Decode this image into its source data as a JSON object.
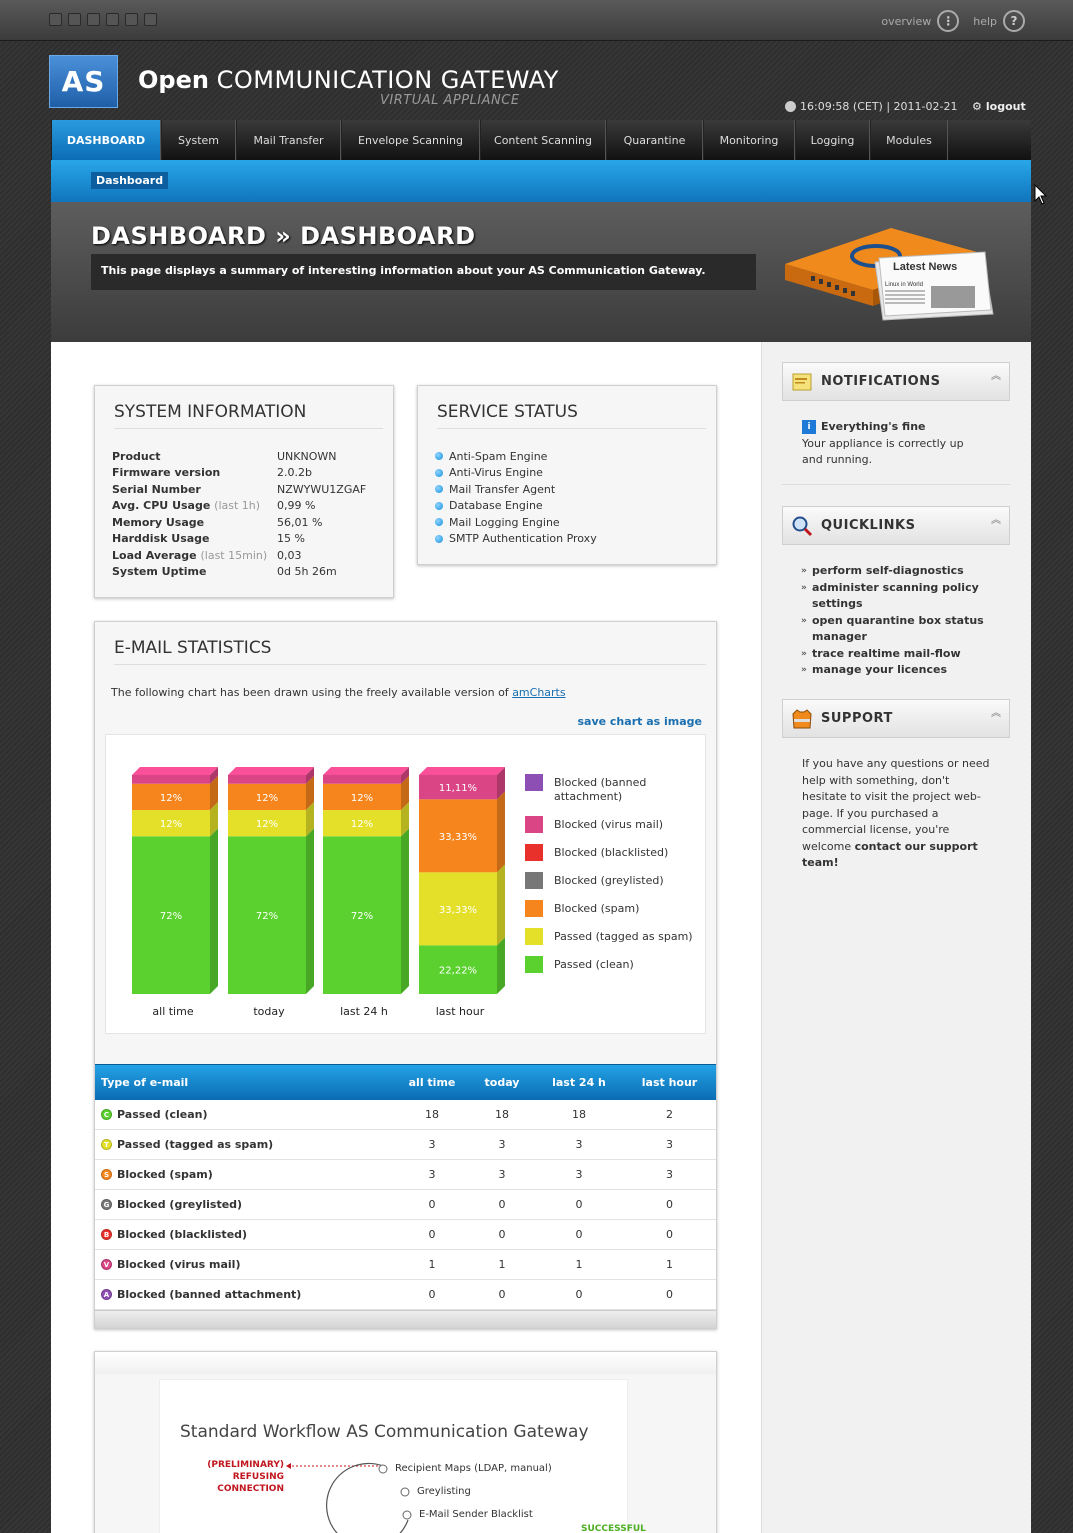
{
  "header": {
    "links": {
      "overview": "overview",
      "help": "help"
    },
    "logo_text": "AS",
    "brand_bold": "Open",
    "brand_rest": "COMMUNICATION GATEWAY",
    "brand_sub": "VIRTUAL APPLIANCE",
    "time": "16:09:58 (CET) | 2011-02-21",
    "logout": "logout"
  },
  "nav": {
    "tabs": [
      "DASHBOARD",
      "System",
      "Mail Transfer",
      "Envelope Scanning",
      "Content Scanning",
      "Quarantine",
      "Monitoring",
      "Logging",
      "Modules"
    ],
    "active": "DASHBOARD"
  },
  "subnav": {
    "item": "Dashboard"
  },
  "hero": {
    "title": "DASHBOARD » DASHBOARD",
    "description": "This page displays a summary of interesting information about your AS Communication Gateway.",
    "news_label": "Latest News",
    "news_headline": "Linux in World"
  },
  "system_info": {
    "title": "SYSTEM INFORMATION",
    "rows": [
      {
        "key": "Product",
        "note": "",
        "value": "UNKNOWN"
      },
      {
        "key": "Firmware version",
        "note": "",
        "value": "2.0.2b"
      },
      {
        "key": "Serial Number",
        "note": "",
        "value": "NZWYWU1ZGAF"
      },
      {
        "key": "Avg. CPU Usage",
        "note": "(last 1h)",
        "value": "0,99 %"
      },
      {
        "key": "Memory Usage",
        "note": "",
        "value": "56,01 %"
      },
      {
        "key": "Harddisk Usage",
        "note": "",
        "value": "15 %"
      },
      {
        "key": "Load Average",
        "note": "(last 15min)",
        "value": "0,03"
      },
      {
        "key": "System Uptime",
        "note": "",
        "value": "0d 5h 26m"
      }
    ]
  },
  "service_status": {
    "title": "SERVICE STATUS",
    "items": [
      "Anti-Spam Engine",
      "Anti-Virus Engine",
      "Mail Transfer Agent",
      "Database Engine",
      "Mail Logging Engine",
      "SMTP Authentication Proxy"
    ]
  },
  "email_stats": {
    "title": "E-MAIL STATISTICS",
    "intro": "The following chart has been drawn using the freely available version of ",
    "intro_link": "amCharts",
    "save": "save chart as image"
  },
  "chart_data": {
    "type": "bar",
    "stacked": true,
    "categories": [
      "all time",
      "today",
      "last 24 h",
      "last hour"
    ],
    "series": [
      {
        "name": "Passed (clean)",
        "color": "#5ad12e",
        "values": [
          72,
          72,
          72,
          22.22
        ],
        "labels": [
          "72%",
          "72%",
          "72%",
          "22,22%"
        ]
      },
      {
        "name": "Passed (tagged as spam)",
        "color": "#e4e029",
        "values": [
          12,
          12,
          12,
          33.33
        ],
        "labels": [
          "12%",
          "12%",
          "12%",
          "33,33%"
        ]
      },
      {
        "name": "Blocked (spam)",
        "color": "#f5851c",
        "values": [
          12,
          12,
          12,
          33.33
        ],
        "labels": [
          "12%",
          "12%",
          "12%",
          "33,33%"
        ]
      },
      {
        "name": "Blocked (greylisted)",
        "color": "#777777",
        "values": [
          0,
          0,
          0,
          0
        ],
        "labels": [
          "",
          "",
          "",
          ""
        ]
      },
      {
        "name": "Blocked (blacklisted)",
        "color": "#e8312a",
        "values": [
          0,
          0,
          0,
          0
        ],
        "labels": [
          "",
          "",
          "",
          ""
        ]
      },
      {
        "name": "Blocked (virus mail)",
        "color": "#d94585",
        "values": [
          4,
          4,
          4,
          11.11
        ],
        "labels": [
          "",
          "",
          "",
          "11,11%"
        ]
      },
      {
        "name": "Blocked (banned attachment)",
        "color": "#8e4fb4",
        "values": [
          0,
          0,
          0,
          0
        ],
        "labels": [
          "",
          "",
          "",
          ""
        ]
      }
    ],
    "legend": [
      "Blocked (banned attachment)",
      "Blocked (virus mail)",
      "Blocked (blacklisted)",
      "Blocked (greylisted)",
      "Blocked (spam)",
      "Passed (tagged as spam)",
      "Passed (clean)"
    ],
    "legend_position": "right",
    "ylim": [
      0,
      100
    ]
  },
  "stats_table": {
    "headers": [
      "Type of e-mail",
      "all time",
      "today",
      "last 24 h",
      "last hour"
    ],
    "rows": [
      {
        "icon": "C",
        "color": "#5ad12e",
        "type": "Passed (clean)",
        "values": [
          "18",
          "18",
          "18",
          "2"
        ]
      },
      {
        "icon": "T",
        "color": "#e4e029",
        "type": "Passed (tagged as spam)",
        "values": [
          "3",
          "3",
          "3",
          "3"
        ]
      },
      {
        "icon": "S",
        "color": "#f5851c",
        "type": "Blocked (spam)",
        "values": [
          "3",
          "3",
          "3",
          "3"
        ]
      },
      {
        "icon": "G",
        "color": "#777777",
        "type": "Blocked (greylisted)",
        "values": [
          "0",
          "0",
          "0",
          "0"
        ]
      },
      {
        "icon": "B",
        "color": "#e8312a",
        "type": "Blocked (blacklisted)",
        "values": [
          "0",
          "0",
          "0",
          "0"
        ]
      },
      {
        "icon": "V",
        "color": "#d94585",
        "type": "Blocked (virus mail)",
        "values": [
          "1",
          "1",
          "1",
          "1"
        ]
      },
      {
        "icon": "A",
        "color": "#8e4fb4",
        "type": "Blocked (banned attachment)",
        "values": [
          "0",
          "0",
          "0",
          "0"
        ]
      }
    ]
  },
  "workflow": {
    "title": "Standard Workflow AS Communication Gateway",
    "refusing": [
      "(PRELIMINARY)",
      "REFUSING CONNECTION"
    ],
    "steps": [
      "Recipient Maps (LDAP, manual)",
      "Greylisting",
      "E-Mail Sender Blacklist"
    ],
    "successful": "SUCCESSFUL"
  },
  "sidebar": {
    "notifications": {
      "title": "NOTIFICATIONS",
      "heading": "Everything's fine",
      "text": "Your appliance is correctly up and running."
    },
    "quicklinks": {
      "title": "QUICKLINKS",
      "items": [
        "perform self-diagnostics",
        "administer scanning policy settings",
        "open quarantine box status manager",
        "trace realtime mail-flow",
        "manage your licences"
      ]
    },
    "support": {
      "title": "SUPPORT",
      "text": "If you have any questions or need help with something, don't hesitate to visit the project web-page. If you purchased a commercial license, you're welcome ",
      "link": "contact our support team!"
    }
  }
}
